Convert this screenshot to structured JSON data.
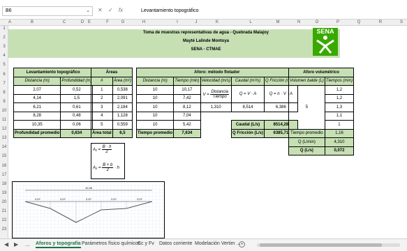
{
  "formula_bar": {
    "name_box": "B6",
    "cancel": "✕",
    "enter": "✓",
    "fx": "fx",
    "content": "Levantamiento topográfico"
  },
  "columns": [
    "A",
    "B",
    "C",
    "D",
    "E",
    "F",
    "G",
    "H",
    "I",
    "J",
    "K",
    "L",
    "M",
    "N",
    "O",
    "P",
    "Q",
    "R",
    "S"
  ],
  "rows": [
    "1",
    "2",
    "3",
    "4",
    "5",
    "6",
    "7",
    "8",
    "9",
    "10",
    "11",
    "12",
    "13",
    "14",
    "15",
    "16",
    "17",
    "18",
    "19",
    "20",
    "21",
    "22",
    "23"
  ],
  "header": {
    "line1": "Toma de muestras representativas de agua - Quebrada Malajoy",
    "line2": "Mayté Lalinde Montoya",
    "line3": "SENA - CTMAE",
    "logo": "SENA"
  },
  "topo": {
    "title": "Levantamiento topográfico",
    "col1": "Distancia (m)",
    "col2": "Profundidad (m)",
    "rows": [
      [
        "2,07",
        "0,52"
      ],
      [
        "4,14",
        "1,5"
      ],
      [
        "6,21",
        "0,61"
      ],
      [
        "8,28",
        "0,48"
      ],
      [
        "10,35",
        "0,06"
      ]
    ],
    "total_label": "Profundidad promedio",
    "total_value": "0,634"
  },
  "areas": {
    "title": "Áreas",
    "col1": "#",
    "col2": "Área (m²)",
    "rows": [
      [
        "1",
        "0,538"
      ],
      [
        "2",
        "2,091"
      ],
      [
        "3",
        "2,184"
      ],
      [
        "4",
        "1,128"
      ],
      [
        "5",
        "0,559"
      ]
    ],
    "total_label": "Área total",
    "total_value": "6,5",
    "f1_left": "A₁ =",
    "f1_num": "B · h",
    "f1_den": "2",
    "f2_left": "A₂ =",
    "f2_num": "B + b",
    "f2_den": "2",
    "f2_right": "· h"
  },
  "aforo": {
    "title": "Aforo: método flotador",
    "col1": "Distancia (m)",
    "col2": "Tiempo (min)",
    "col3": "Velocidad (m/s)",
    "col4": "Caudal (m³/s)",
    "col5": "Q Fricción (m³/s)",
    "rows": [
      [
        "10",
        "10,17"
      ],
      [
        "10",
        "7,42"
      ],
      [
        "10",
        "8,12"
      ],
      [
        "10",
        "7,04"
      ],
      [
        "10",
        "5,42"
      ]
    ],
    "v_formula_left": "V =",
    "v_num": "Distancia",
    "v_den": "Tiempo",
    "q_formula": "Q = V · A",
    "qf_formula": "Q = n · V · A",
    "velocidad": "1,310",
    "caudal": "8,514",
    "qfriccion": "6,386",
    "tprom_label": "Tiempo promedio",
    "tprom_value": "7,634",
    "caudal_label": "Caudal (L/s)",
    "caudal_total": "8514,28",
    "qf_label": "Q Fricción (L/s)",
    "qf_total": "6385,71"
  },
  "volumetrico": {
    "title": "Aforo volumétrico",
    "col1": "Volumen balde (L)",
    "col2": "Tiempos (min)",
    "volume": "5",
    "times": [
      "1,2",
      "1,2",
      "1,3",
      "1,1",
      "1"
    ],
    "tprom_label": "Tiempo promedio",
    "tprom_value": "1,16",
    "qlmin_label": "Q (L/min)",
    "qlmin_value": "4,310",
    "qls_label": "Q (L/s)",
    "qls_value": "0,072"
  },
  "drawing": {
    "total_width": "10,35",
    "segment_labels": [
      "2,07",
      "2,07",
      "2,07",
      "2,07",
      "2,07"
    ]
  },
  "tabs": {
    "items": [
      "Aforos y topografía",
      "Parámetros físico químicos",
      "Cc y Fv",
      "Datos corriente",
      "Modelación Vertim ..."
    ],
    "active": 0,
    "prev": "◀",
    "next": "▶",
    "ellipsis": "...",
    "add": "+"
  },
  "colors": {
    "header_green": "#c6e0b4",
    "sena_green": "#39a900",
    "active_tab": "#1e7145"
  }
}
